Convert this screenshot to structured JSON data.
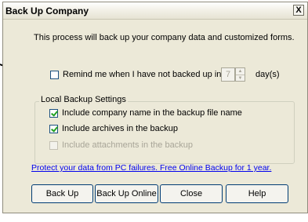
{
  "window": {
    "title": "Back Up Company",
    "close_glyph": "X"
  },
  "intro_text": "This process will back up your company data and customized forms.",
  "reminder": {
    "label": "Remind me when I have not backed up in",
    "days_value": "7",
    "days_unit": "day(s)",
    "checked": false
  },
  "local_backup": {
    "title": "Local Backup Settings",
    "options": [
      {
        "label": "Include company name in the backup file name",
        "checked": true,
        "enabled": true
      },
      {
        "label": "Include archives in the backup",
        "checked": true,
        "enabled": true
      },
      {
        "label": "Include attachments in the backup",
        "checked": false,
        "enabled": false
      }
    ]
  },
  "promo_link": "Protect your data from PC failures.  Free Online Backup for 1 year.",
  "buttons": {
    "back_up": "Back Up",
    "back_up_online": "Back Up Online",
    "close": "Close",
    "help": "Help"
  },
  "icons": {
    "arrow": "pointer-arrow-icon",
    "spin_up": "spin-up-icon",
    "spin_down": "spin-down-icon"
  }
}
